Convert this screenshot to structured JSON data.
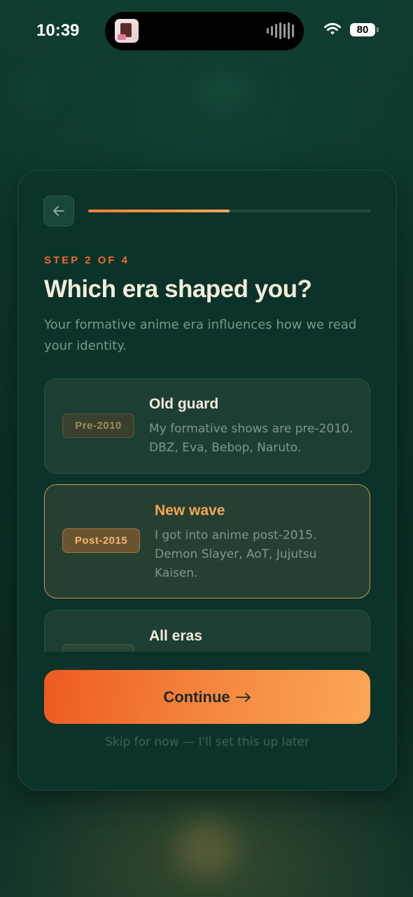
{
  "status_bar": {
    "time": "10:39",
    "battery": "80"
  },
  "progress": {
    "fraction": 0.5
  },
  "header": {
    "step": "STEP 2 OF 4",
    "title": "Which era shaped you?",
    "subtitle": "Your formative anime era influences how we read your identity."
  },
  "options": [
    {
      "badge": "Pre-2010",
      "title": "Old guard",
      "description": "My formative shows are pre-2010. DBZ, Eva, Bebop, Naruto.",
      "selected": false
    },
    {
      "badge": "Post-2015",
      "title": "New wave",
      "description": "I got into anime post-2015. Demon Slayer, AoT, Jujutsu Kaisen.",
      "selected": true
    },
    {
      "badge": "",
      "title": "All eras",
      "description": "",
      "selected": false
    }
  ],
  "actions": {
    "continue_label": "Continue",
    "skip_label": "Skip for now — I'll set this up later"
  },
  "colors": {
    "accent": "#ee6a2c",
    "selected_border": "#c79a55",
    "background": "#0b3329"
  },
  "icons": {
    "back": "arrow-left-icon",
    "continue": "arrow-right-icon",
    "wifi": "wifi-icon",
    "battery": "battery-icon"
  }
}
